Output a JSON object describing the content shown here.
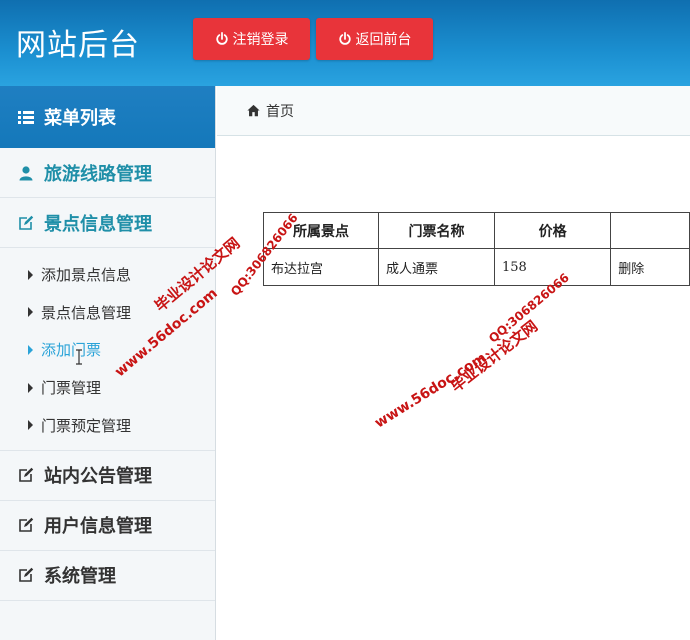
{
  "header": {
    "title": "网站后台",
    "logout_label": "注销登录",
    "front_label": "返回前台"
  },
  "sidebar": {
    "title": "菜单列表",
    "items": [
      {
        "label": "旅游线路管理",
        "icon": "user-icon"
      },
      {
        "label": "景点信息管理",
        "icon": "edit-icon"
      },
      {
        "label": "站内公告管理",
        "icon": "edit-icon"
      },
      {
        "label": "用户信息管理",
        "icon": "edit-icon"
      },
      {
        "label": "系统管理",
        "icon": "edit-icon"
      }
    ],
    "subitems": [
      {
        "label": "添加景点信息"
      },
      {
        "label": "景点信息管理"
      },
      {
        "label": "添加门票"
      },
      {
        "label": "门票管理"
      },
      {
        "label": "门票预定管理"
      }
    ]
  },
  "breadcrumb": {
    "home": "首页"
  },
  "table": {
    "headers": [
      "所属景点",
      "门票名称",
      "价格",
      ""
    ],
    "rows": [
      [
        "布达拉宫",
        "成人通票",
        "158",
        "删除"
      ]
    ]
  },
  "watermarks": {
    "site": "www.56doc.com",
    "qq": "QQ:306826066",
    "brand": "毕业设计论文网"
  },
  "colors": {
    "header": "#1b8fd0",
    "button": "#e8343a",
    "accent": "#1f8fa8",
    "active": "#2aa3d8",
    "watermark": "#c81414"
  }
}
